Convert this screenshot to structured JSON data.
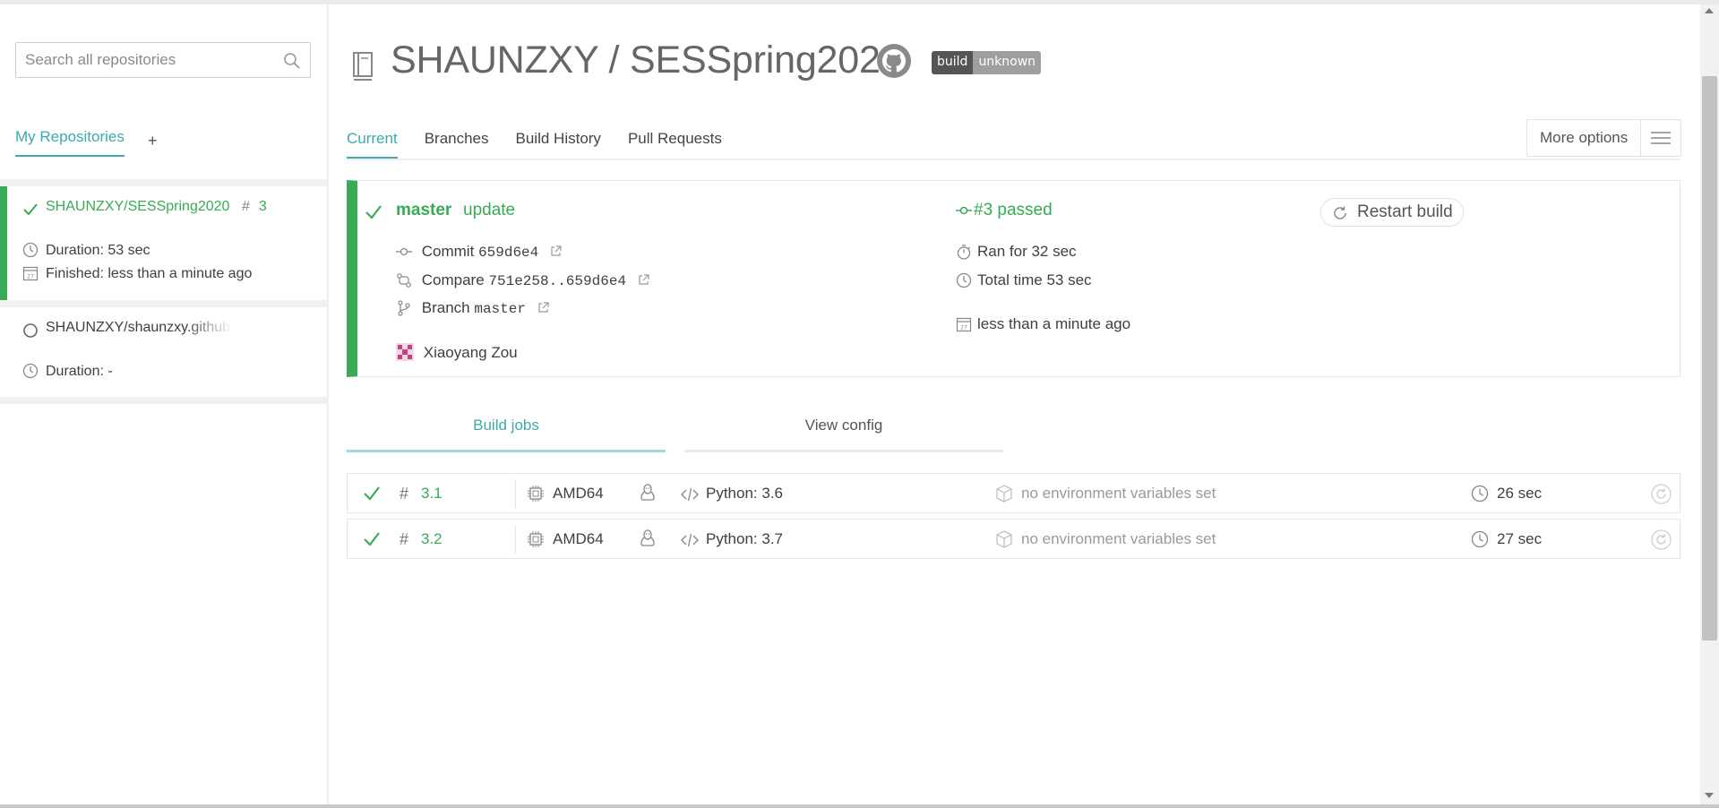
{
  "sidebar": {
    "search_placeholder": "Search all repositories",
    "tab_label": "My Repositories",
    "add_label": "+",
    "repos": [
      {
        "name": "SHAUNZXY/SESSpring2020",
        "build_hash": "#",
        "build_num": "3",
        "duration": "Duration: 53 sec",
        "finished": "Finished: less than a minute ago",
        "status": "passed"
      },
      {
        "name": "SHAUNZXY/shaunzxy.github.io",
        "duration": "Duration: -",
        "status": "none"
      }
    ]
  },
  "repo": {
    "title": "SHAUNZXY / SESSpring2020",
    "badge_left": "build",
    "badge_right": "unknown"
  },
  "nav": {
    "tabs": [
      "Current",
      "Branches",
      "Build History",
      "Pull Requests"
    ],
    "more_options": "More options"
  },
  "build": {
    "branch": "master",
    "message": "update",
    "commit_label": "Commit",
    "commit_sha": "659d6e4",
    "compare_label": "Compare",
    "compare_range": "751e258..659d6e4",
    "branch_label": "Branch",
    "branch_name": "master",
    "author": "Xiaoyang Zou",
    "status": "#3 passed",
    "ran_for": "Ran for 32 sec",
    "total_time": "Total time 53 sec",
    "finished": "less than a minute ago",
    "restart": "Restart build"
  },
  "job_tabs": [
    "Build jobs",
    "View config"
  ],
  "jobs": [
    {
      "num": "3.1",
      "arch": "AMD64",
      "lang": "Python: 3.6",
      "env": "no environment variables set",
      "duration": "26 sec"
    },
    {
      "num": "3.2",
      "arch": "AMD64",
      "lang": "Python: 3.7",
      "env": "no environment variables set",
      "duration": "27 sec"
    }
  ],
  "colors": {
    "accent": "#3eaaaf",
    "passed": "#39aa56",
    "text": "#3f3f3f"
  }
}
